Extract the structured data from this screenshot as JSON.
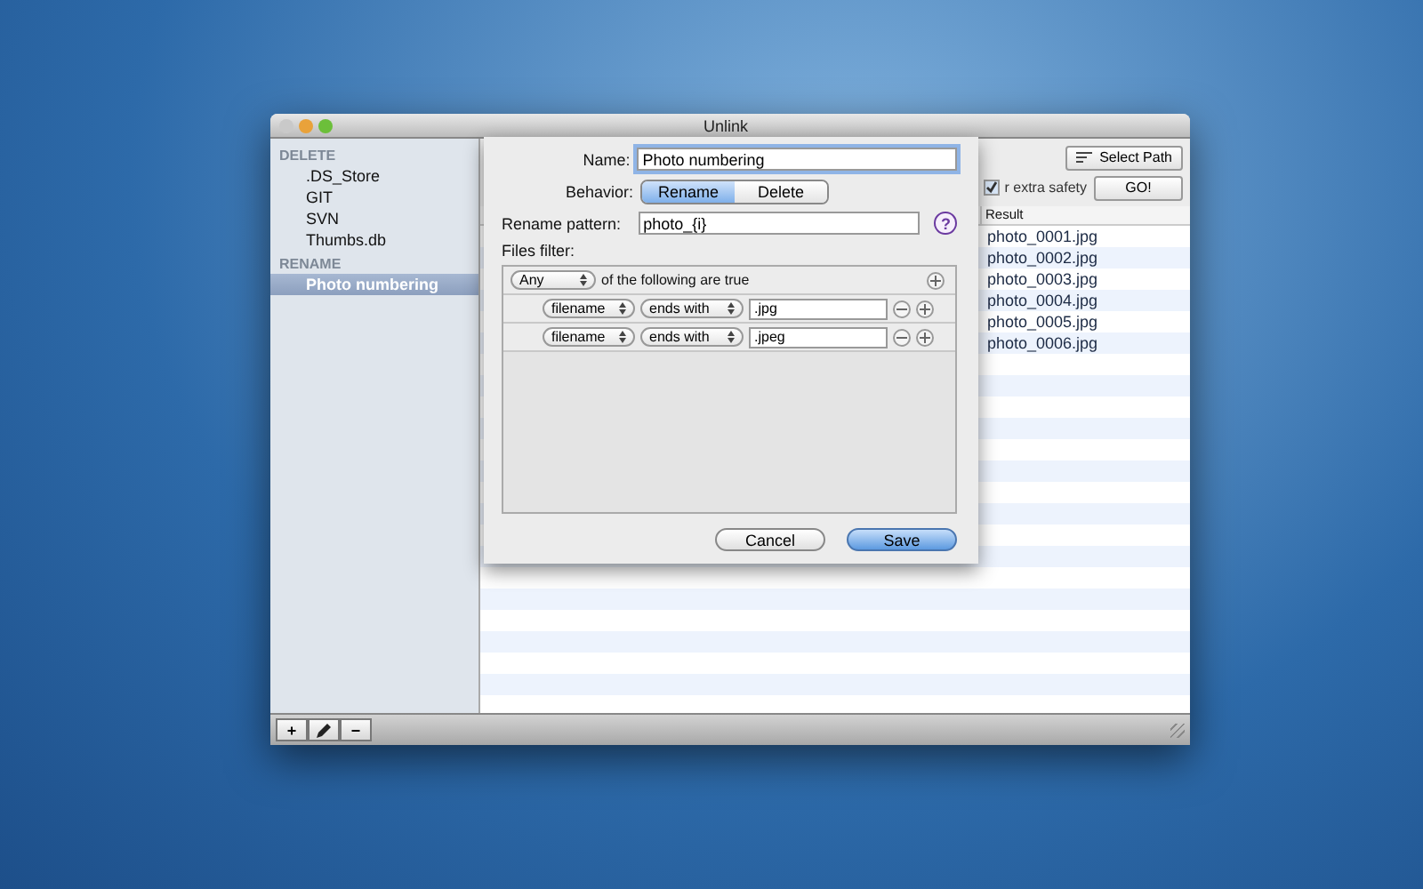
{
  "window": {
    "title": "Unlink"
  },
  "sidebar": {
    "groups": [
      {
        "heading": "DELETE",
        "items": [
          {
            "label": ".DS_Store",
            "selected": false
          },
          {
            "label": "GIT",
            "selected": false
          },
          {
            "label": "SVN",
            "selected": false
          },
          {
            "label": "Thumbs.db",
            "selected": false
          }
        ]
      },
      {
        "heading": "RENAME",
        "items": [
          {
            "label": "Photo numbering",
            "selected": true
          }
        ]
      }
    ]
  },
  "toolbar": {
    "select_path": "Select Path",
    "go": "GO!",
    "safety": {
      "label": "r extra safety",
      "checked": true
    }
  },
  "table": {
    "columns": [
      "Result"
    ],
    "rows": [
      "photo_0001.jpg",
      "photo_0002.jpg",
      "photo_0003.jpg",
      "photo_0004.jpg",
      "photo_0005.jpg",
      "photo_0006.jpg"
    ]
  },
  "sheet": {
    "name_label": "Name:",
    "name": "Photo numbering",
    "behavior_label": "Behavior:",
    "behavior": [
      {
        "label": "Rename",
        "selected": true
      },
      {
        "label": "Delete",
        "selected": false
      }
    ],
    "pattern_label": "Rename pattern:",
    "pattern": "photo_{i}",
    "help": "?",
    "filter_label": "Files filter:",
    "match": "Any",
    "match_text": "of the following are true",
    "rules": [
      {
        "field": "filename",
        "op": "ends with",
        "value": ".jpg"
      },
      {
        "field": "filename",
        "op": "ends with",
        "value": ".jpeg"
      }
    ],
    "buttons": [
      {
        "label": "Cancel",
        "kind": "secondary"
      },
      {
        "label": "Save",
        "kind": "default"
      }
    ]
  },
  "bottom_bar": {
    "add": "+",
    "remove": "−"
  }
}
